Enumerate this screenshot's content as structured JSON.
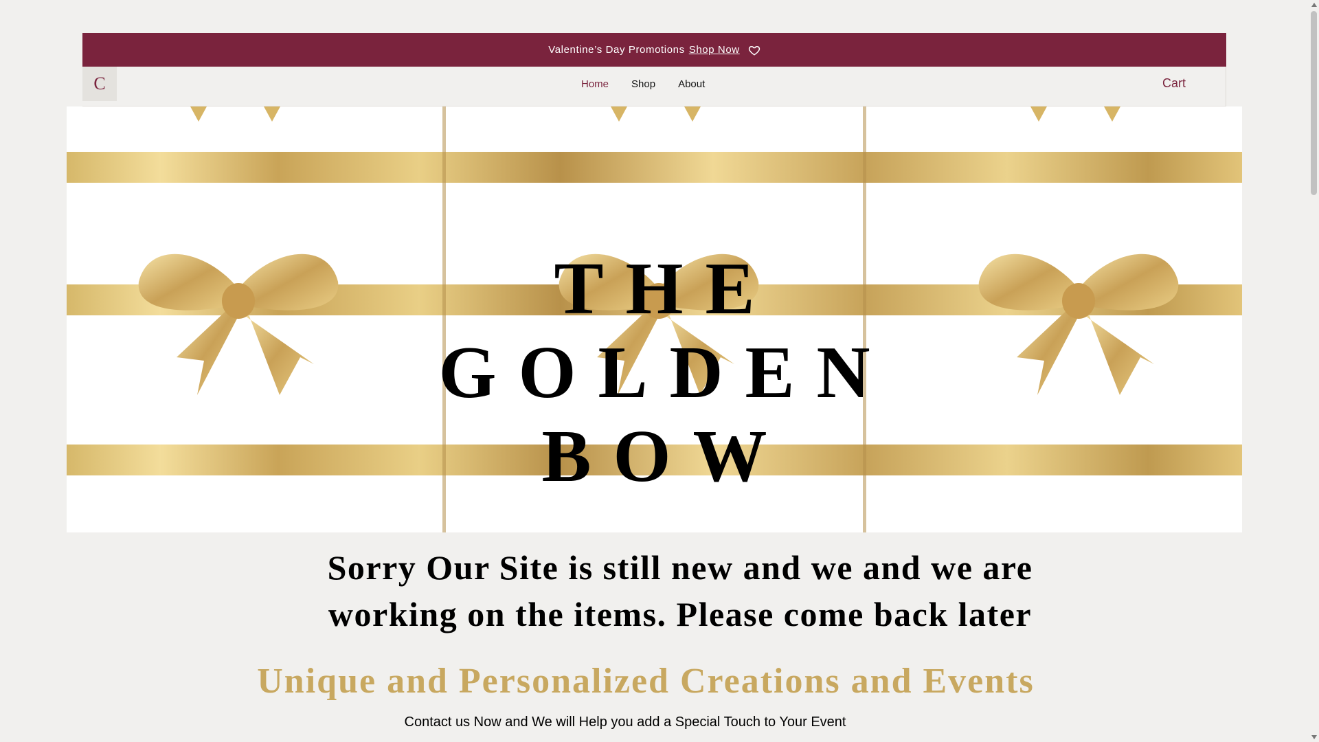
{
  "promo": {
    "text": "Valentine’s Day Promotions",
    "link": "Shop Now",
    "icon": "heart-icon"
  },
  "header": {
    "logo_letter": "C",
    "nav": [
      {
        "label": "Home",
        "active": true
      },
      {
        "label": "Shop",
        "active": false
      },
      {
        "label": "About",
        "active": false
      }
    ],
    "cart_label": "Cart"
  },
  "hero": {
    "title_lines": [
      "THE",
      "GOLDEN",
      "BOW"
    ]
  },
  "notice": {
    "line1": "Sorry Our Site is still new and we and we are",
    "line2": "working on the items. Please come back later"
  },
  "tagline": "Unique and Personalized Creations and Events",
  "contact_text": "Contact us Now and We will Help you add a Special Touch to Your Event",
  "colors": {
    "accent": "#7a233d",
    "gold": "#c8a860",
    "background": "#f1f0ee"
  }
}
